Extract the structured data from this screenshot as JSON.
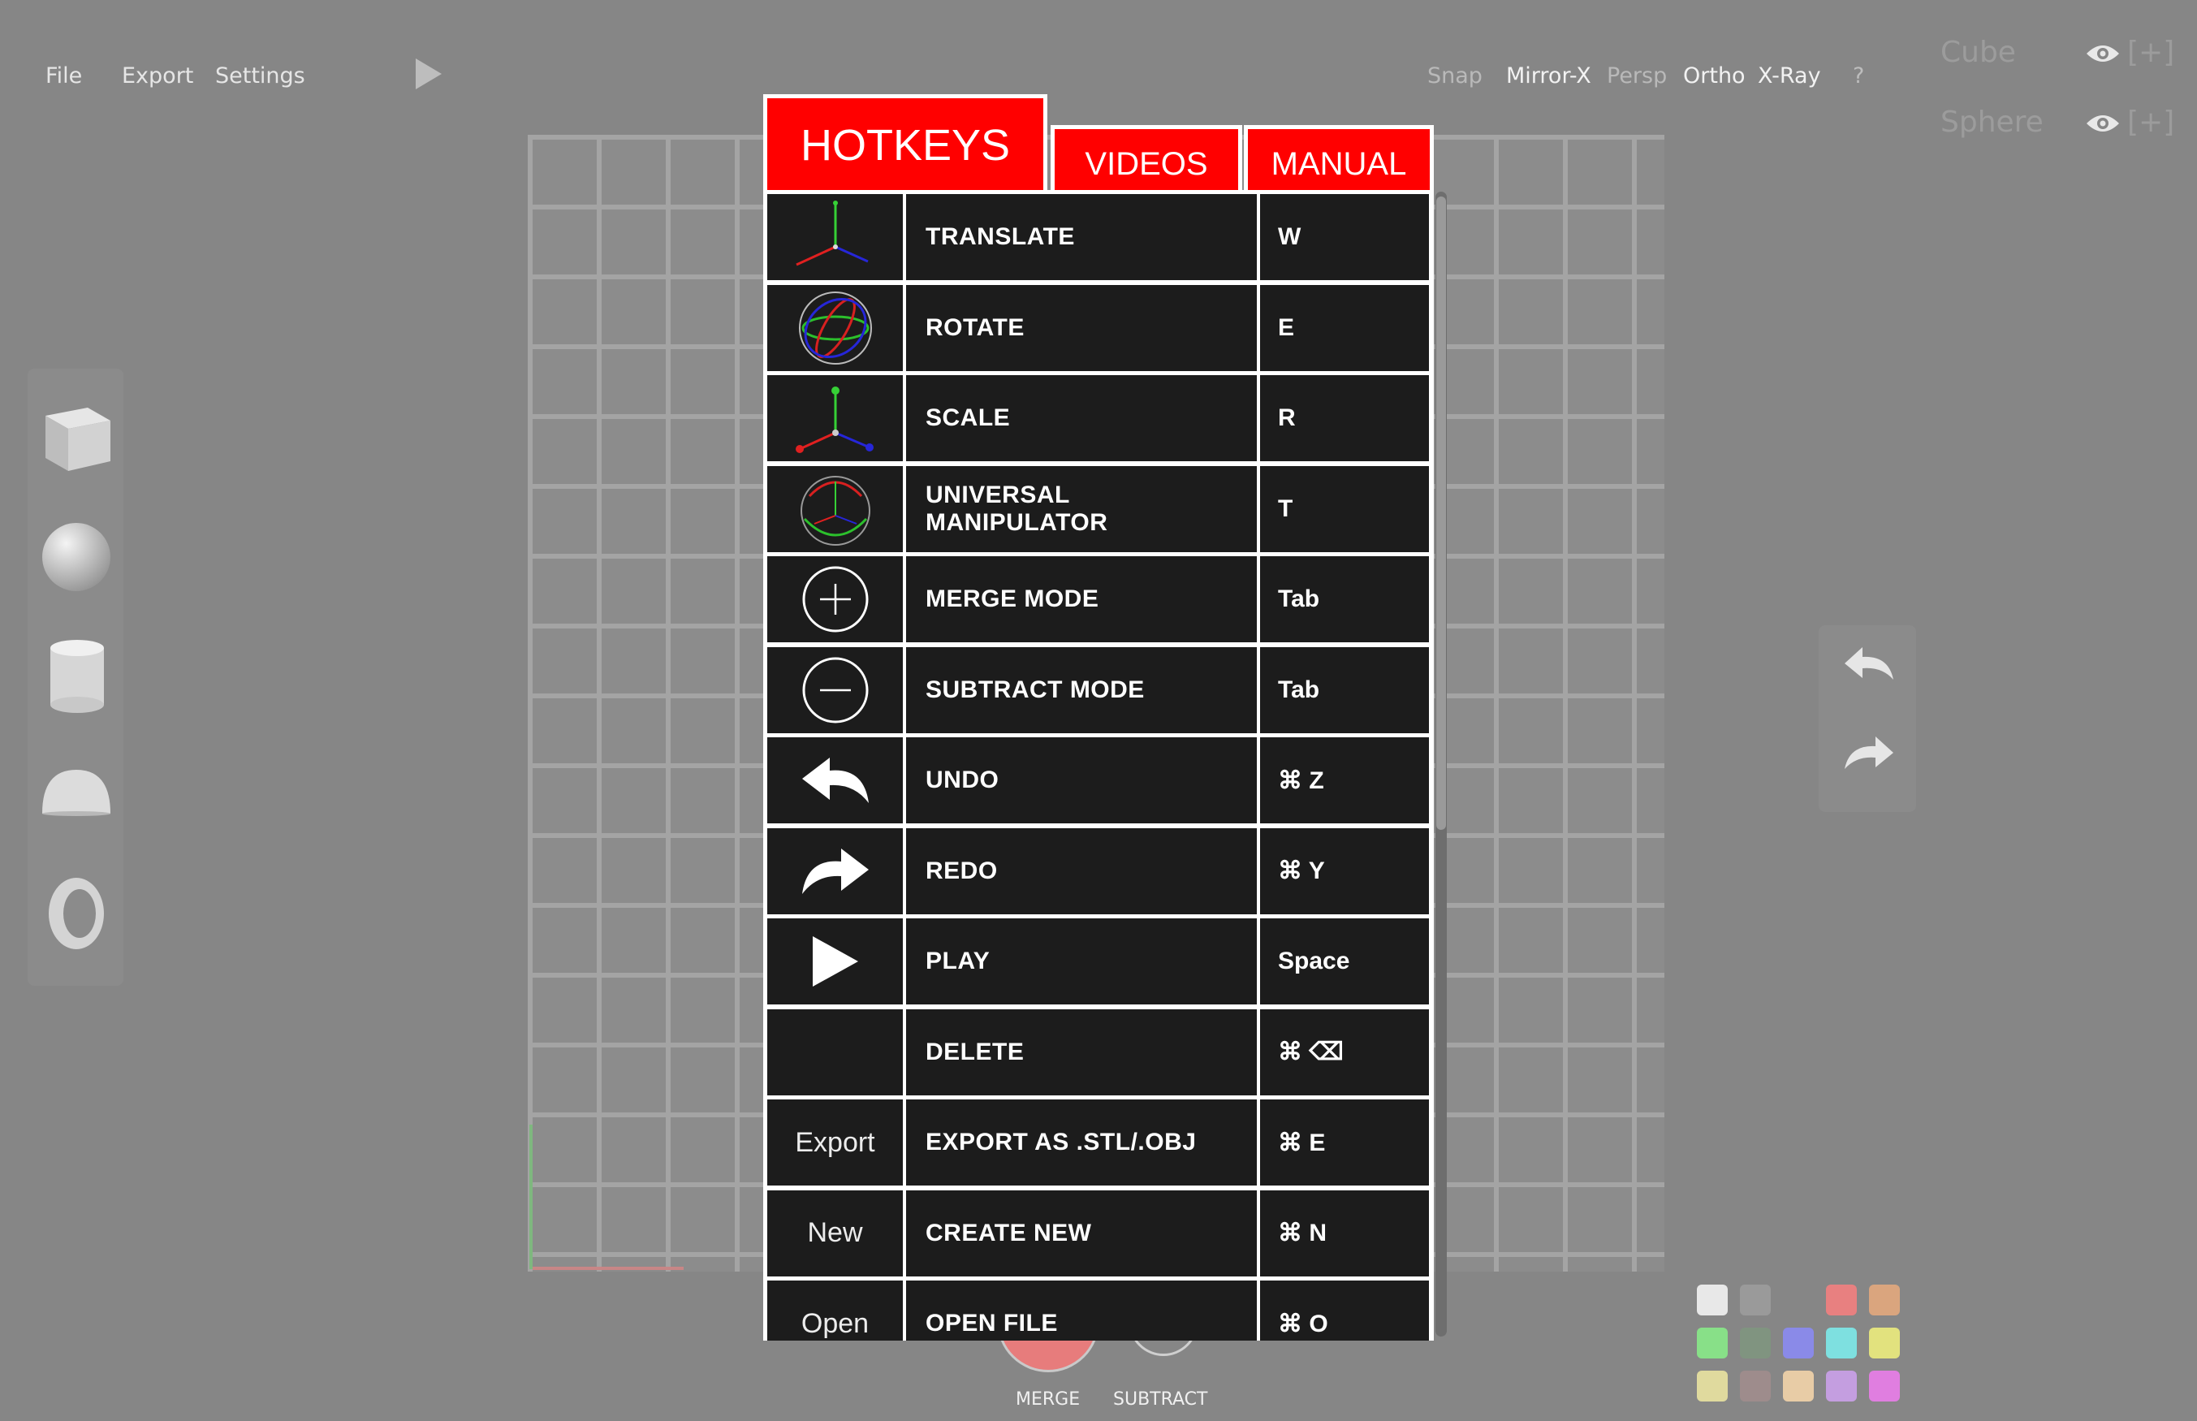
{
  "menu": {
    "file": "File",
    "export": "Export",
    "settings": "Settings"
  },
  "toolbar": {
    "snap": "Snap",
    "mirror_x": "Mirror-X",
    "persp": "Persp",
    "ortho": "Ortho",
    "xray": "X-Ray",
    "help": "?"
  },
  "objects": [
    {
      "name": "Cube",
      "add": "[+]"
    },
    {
      "name": "Sphere",
      "add": "[+]"
    }
  ],
  "tabs": {
    "hotkeys": "HOTKEYS",
    "videos": "VIDEOS",
    "manual": "MANUAL"
  },
  "hotkeys": [
    {
      "icon": "translate-gizmo-icon",
      "label": "",
      "action": "TRANSLATE",
      "key": "W"
    },
    {
      "icon": "rotate-gizmo-icon",
      "label": "",
      "action": "ROTATE",
      "key": "E"
    },
    {
      "icon": "scale-gizmo-icon",
      "label": "",
      "action": "SCALE",
      "key": "R"
    },
    {
      "icon": "universal-manipulator-icon",
      "label": "",
      "action": "UNIVERSAL MANIPULATOR",
      "key": "T"
    },
    {
      "icon": "plus-circle-icon",
      "label": "",
      "action": "MERGE MODE",
      "key": "Tab"
    },
    {
      "icon": "minus-circle-icon",
      "label": "",
      "action": "SUBTRACT MODE",
      "key": "Tab"
    },
    {
      "icon": "undo-arrow-icon",
      "label": "",
      "action": "UNDO",
      "key": "⌘ Z"
    },
    {
      "icon": "redo-arrow-icon",
      "label": "",
      "action": "REDO",
      "key": "⌘ Y"
    },
    {
      "icon": "play-icon",
      "label": "",
      "action": "PLAY",
      "key": "Space"
    },
    {
      "icon": "",
      "label": "",
      "action": "DELETE",
      "key": "⌘ ⌫"
    },
    {
      "icon": "",
      "label": "Export",
      "action": "EXPORT AS .STL/.OBJ",
      "key": "⌘ E"
    },
    {
      "icon": "",
      "label": "New",
      "action": "CREATE NEW",
      "key": "⌘ N"
    },
    {
      "icon": "",
      "label": "Open",
      "action": "OPEN FILE",
      "key": "⌘ O"
    }
  ],
  "bottom": {
    "merge": "MERGE",
    "subtract": "SUBTRACT"
  },
  "palette": [
    "#e8e8e8",
    "#9a9a9a",
    "",
    "#e88080",
    "#daa57e",
    "#88e088",
    "#809480",
    "#8a8ae8",
    "#7ee0e0",
    "#e2e27e",
    "#e0da9e",
    "#9e8c8c",
    "#e8cca6",
    "#c49ee0",
    "#e07ee0"
  ],
  "colors": {
    "accent": "#ff0000",
    "panel": "#1c1c1c",
    "background": "#868686"
  }
}
